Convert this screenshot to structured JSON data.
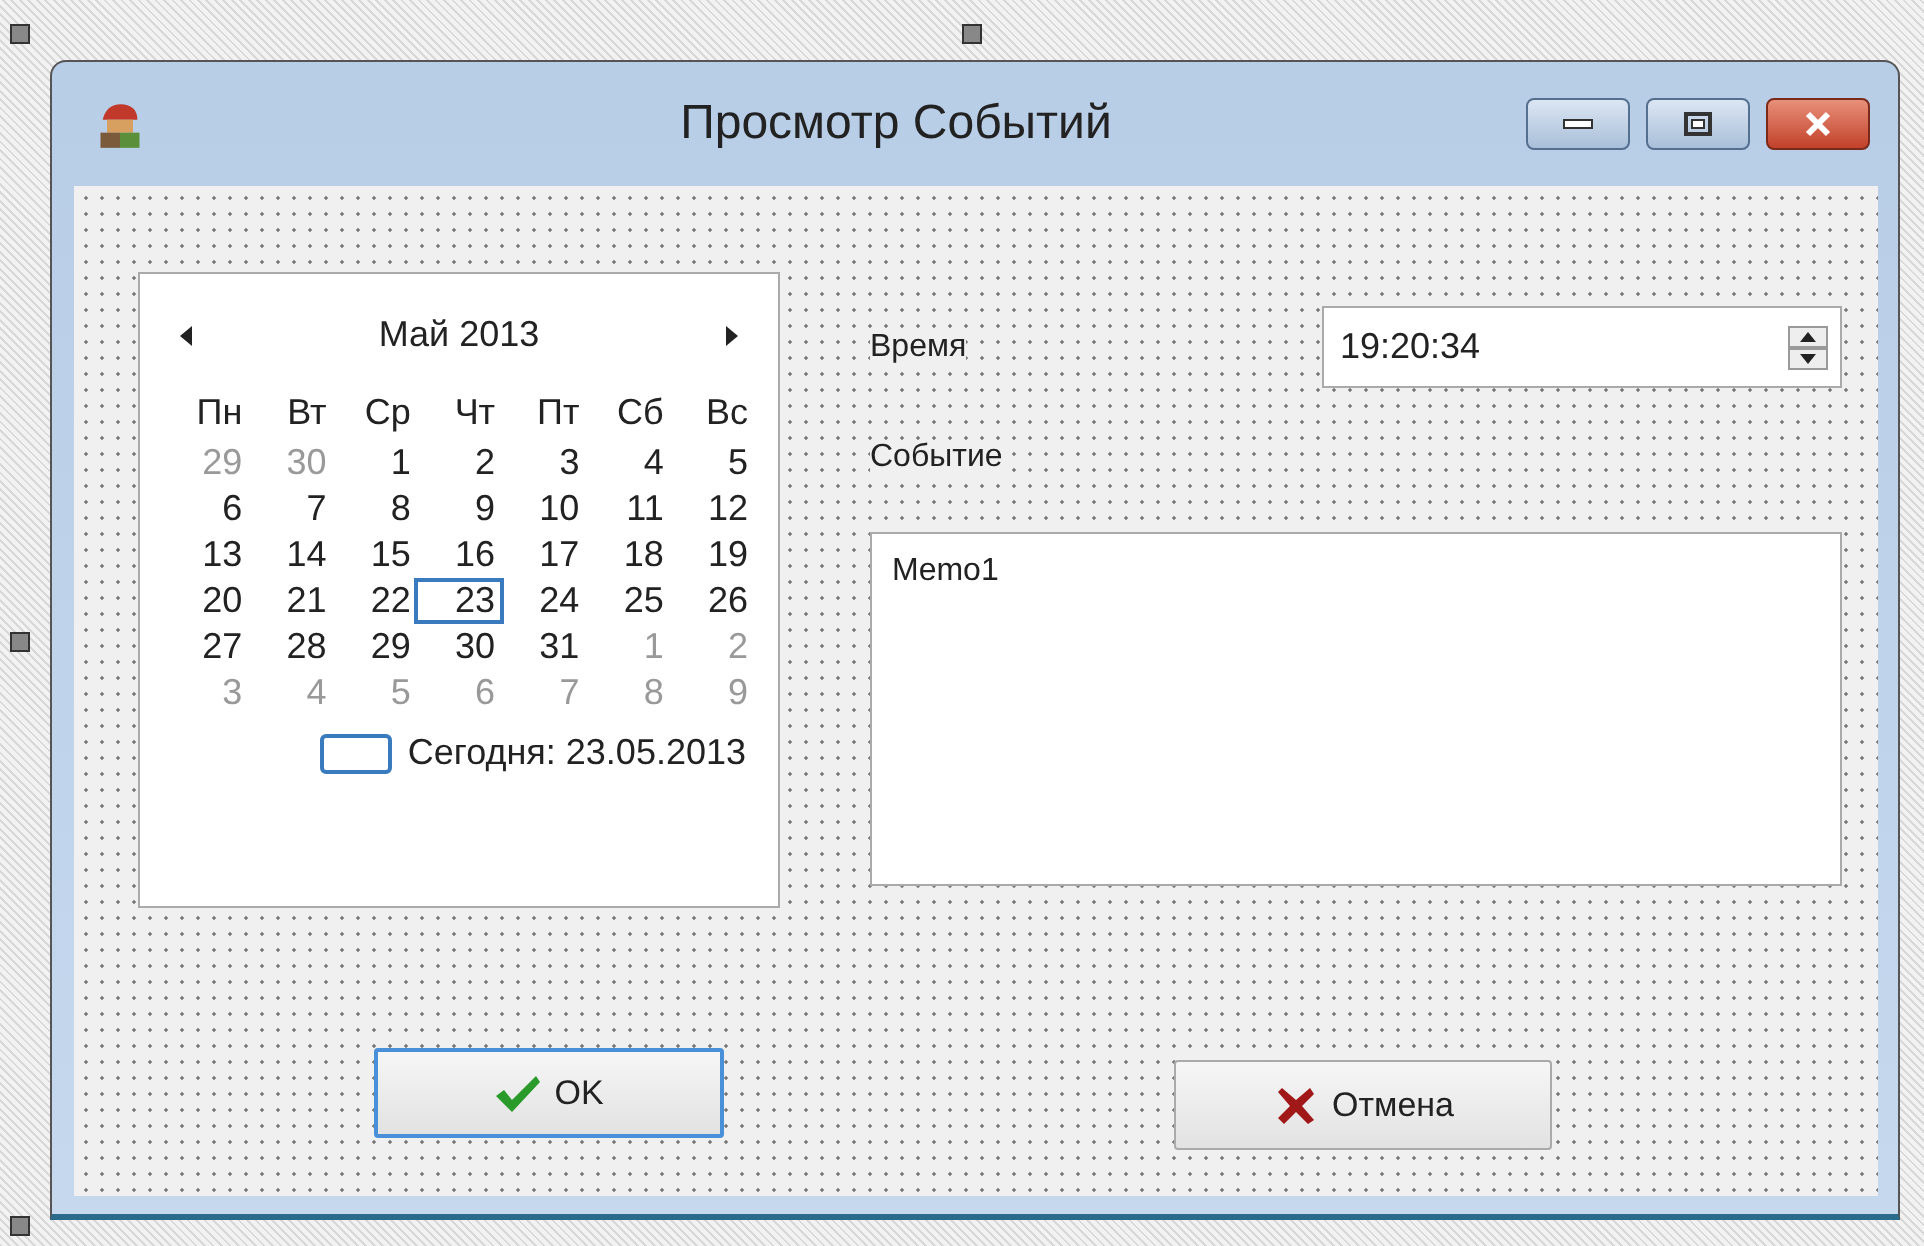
{
  "window": {
    "title": "Просмотр Событий"
  },
  "calendar": {
    "month": "Май 2013",
    "weekdays": [
      "Пн",
      "Вт",
      "Ср",
      "Чт",
      "Пт",
      "Сб",
      "Вс"
    ],
    "weeks": [
      [
        {
          "day": "29",
          "other_month": true,
          "selected": false
        },
        {
          "day": "30",
          "other_month": true,
          "selected": false
        },
        {
          "day": "1",
          "other_month": false,
          "selected": false
        },
        {
          "day": "2",
          "other_month": false,
          "selected": false
        },
        {
          "day": "3",
          "other_month": false,
          "selected": false
        },
        {
          "day": "4",
          "other_month": false,
          "selected": false
        },
        {
          "day": "5",
          "other_month": false,
          "selected": false
        }
      ],
      [
        {
          "day": "6",
          "other_month": false,
          "selected": false
        },
        {
          "day": "7",
          "other_month": false,
          "selected": false
        },
        {
          "day": "8",
          "other_month": false,
          "selected": false
        },
        {
          "day": "9",
          "other_month": false,
          "selected": false
        },
        {
          "day": "10",
          "other_month": false,
          "selected": false
        },
        {
          "day": "11",
          "other_month": false,
          "selected": false
        },
        {
          "day": "12",
          "other_month": false,
          "selected": false
        }
      ],
      [
        {
          "day": "13",
          "other_month": false,
          "selected": false
        },
        {
          "day": "14",
          "other_month": false,
          "selected": false
        },
        {
          "day": "15",
          "other_month": false,
          "selected": false
        },
        {
          "day": "16",
          "other_month": false,
          "selected": false
        },
        {
          "day": "17",
          "other_month": false,
          "selected": false
        },
        {
          "day": "18",
          "other_month": false,
          "selected": false
        },
        {
          "day": "19",
          "other_month": false,
          "selected": false
        }
      ],
      [
        {
          "day": "20",
          "other_month": false,
          "selected": false
        },
        {
          "day": "21",
          "other_month": false,
          "selected": false
        },
        {
          "day": "22",
          "other_month": false,
          "selected": false
        },
        {
          "day": "23",
          "other_month": false,
          "selected": true
        },
        {
          "day": "24",
          "other_month": false,
          "selected": false
        },
        {
          "day": "25",
          "other_month": false,
          "selected": false
        },
        {
          "day": "26",
          "other_month": false,
          "selected": false
        }
      ],
      [
        {
          "day": "27",
          "other_month": false,
          "selected": false
        },
        {
          "day": "28",
          "other_month": false,
          "selected": false
        },
        {
          "day": "29",
          "other_month": false,
          "selected": false
        },
        {
          "day": "30",
          "other_month": false,
          "selected": false
        },
        {
          "day": "31",
          "other_month": false,
          "selected": false
        },
        {
          "day": "1",
          "other_month": true,
          "selected": false
        },
        {
          "day": "2",
          "other_month": true,
          "selected": false
        }
      ],
      [
        {
          "day": "3",
          "other_month": true,
          "selected": false
        },
        {
          "day": "4",
          "other_month": true,
          "selected": false
        },
        {
          "day": "5",
          "other_month": true,
          "selected": false
        },
        {
          "day": "6",
          "other_month": true,
          "selected": false
        },
        {
          "day": "7",
          "other_month": true,
          "selected": false
        },
        {
          "day": "8",
          "other_month": true,
          "selected": false
        },
        {
          "day": "9",
          "other_month": true,
          "selected": false
        }
      ]
    ],
    "today": "Сегодня: 23.05.2013"
  },
  "time": {
    "label": "Время",
    "value": "19:20:34"
  },
  "event": {
    "label": "Событие",
    "memo": "Memo1"
  },
  "buttons": [
    {
      "label": "OK",
      "kind": "ok",
      "focused": true
    },
    {
      "label": "Отмена",
      "kind": "cancel",
      "focused": false
    }
  ]
}
